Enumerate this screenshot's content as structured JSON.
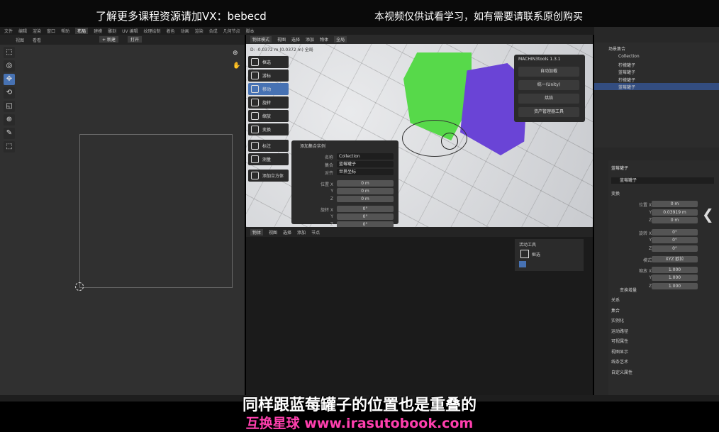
{
  "banner": {
    "left": "了解更多课程资源请加VX：bebecd",
    "right": "本视频仅供试看学习，如有需要请联系原创购买"
  },
  "topbar": {
    "items": [
      "文件",
      "编辑",
      "渲染",
      "窗口",
      "帮助",
      "布局",
      "建模",
      "雕刻",
      "UV 编辑",
      "纹理绘制",
      "着色",
      "动画",
      "渲染",
      "合成",
      "几何节点",
      "脚本"
    ],
    "active_index": 5
  },
  "left_editor": {
    "header": [
      "视图",
      "看看"
    ],
    "buttons": [
      "+ 新建",
      "打开"
    ],
    "tools": [
      "⬚",
      "◎",
      "✥",
      "⟲",
      "◱",
      "⊕",
      "✎",
      "⬚"
    ]
  },
  "viewport": {
    "header": [
      "视图",
      "选择",
      "添加",
      "物体"
    ],
    "mode": "物体模式",
    "global": "全局",
    "info": "D: -0.0372 m (0.0372 m) 全局",
    "tools": [
      {
        "label": "框选",
        "sel": false
      },
      {
        "label": "游标",
        "sel": false
      },
      {
        "label": "移动",
        "sel": true
      },
      {
        "label": "旋转",
        "sel": false
      },
      {
        "label": "缩放",
        "sel": false
      },
      {
        "label": "变换",
        "sel": false
      },
      {
        "label": "标注",
        "sel": false
      },
      {
        "label": "测量",
        "sel": false
      },
      {
        "label": "添加立方体",
        "sel": false
      }
    ]
  },
  "machin_panel": {
    "title": "MACHIN3tools 1.3.1",
    "buttons": [
      "自动加载",
      "统一(Unity)",
      "烘焙",
      "资产管理器工具"
    ]
  },
  "redo_panel": {
    "title": "添加集合实例",
    "rows": [
      {
        "label": "名称",
        "value": "Collection"
      },
      {
        "label": "集合",
        "value": "蓝莓罐子"
      },
      {
        "label": "对齐",
        "value": "世界坐标"
      },
      {
        "label": "位置 X",
        "value": "0 m"
      },
      {
        "label": "Y",
        "value": "0 m"
      },
      {
        "label": "Z",
        "value": "0 m"
      },
      {
        "label": "旋转 X",
        "value": "0°"
      },
      {
        "label": "Y",
        "value": "0°"
      },
      {
        "label": "Z",
        "value": "0°"
      }
    ]
  },
  "lower_editor": {
    "header": [
      "物体",
      "视图",
      "选择",
      "添加",
      "节点"
    ],
    "active_tool_title": "活动工具",
    "active_tool_label": "框选"
  },
  "outliner": {
    "scene": "场景集合",
    "items": [
      {
        "name": "Collection",
        "sel": false
      },
      {
        "name": "柠檬罐子",
        "sel": false
      },
      {
        "name": "蓝莓罐子",
        "sel": false
      },
      {
        "name": "柠檬罐子",
        "sel": false
      },
      {
        "name": "蓝莓罐子",
        "sel": true
      }
    ]
  },
  "properties": {
    "object_name": "蓝莓罐子",
    "data_name": "蓝莓罐子",
    "section_transform": "变换",
    "rows": [
      {
        "label": "位置 X",
        "value": "0 m"
      },
      {
        "label": "Y",
        "value": "0.03919 m"
      },
      {
        "label": "Z",
        "value": "0 m"
      },
      {
        "label": "旋转 X",
        "value": "0°"
      },
      {
        "label": "Y",
        "value": "0°"
      },
      {
        "label": "Z",
        "value": "0°"
      },
      {
        "label": "模式",
        "value": "XYZ 欧拉"
      },
      {
        "label": "缩放 X",
        "value": "1.000"
      },
      {
        "label": "Y",
        "value": "1.000"
      },
      {
        "label": "Z",
        "value": "1.000"
      }
    ],
    "delta": "变换增量",
    "sections": [
      "关系",
      "集合",
      "实例化",
      "运动路径",
      "可视属性",
      "视图显示",
      "线条艺术",
      "自定义属性"
    ]
  },
  "subtitle": {
    "main": "同样跟蓝莓罐子的位置也是重叠的",
    "watermark": "互换星球 www.irasutobook.com"
  }
}
